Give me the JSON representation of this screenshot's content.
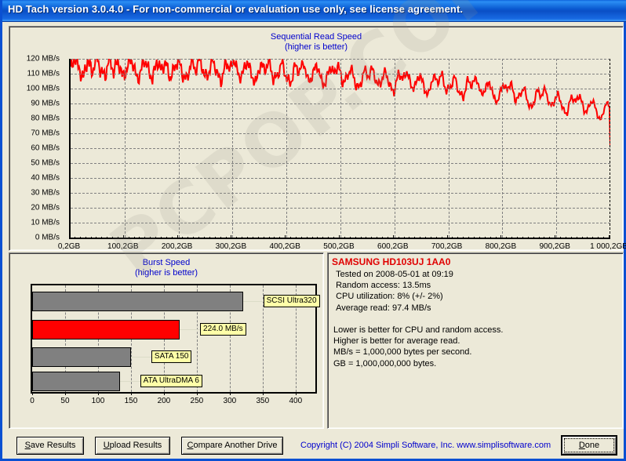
{
  "window": {
    "title": "HD Tach version 3.0.4.0  - For non-commercial or evaluation use only, see license agreement.",
    "watermark": "PCPOP.COM",
    "accent_color": "#0a50d2",
    "face_color": "#ece9d8"
  },
  "sequential": {
    "title_line1": "Sequential Read Speed",
    "title_line2": "(higher is better)",
    "y_labels": [
      "120 MB/s",
      "110 MB/s",
      "100 MB/s",
      "90 MB/s",
      "80 MB/s",
      "70 MB/s",
      "60 MB/s",
      "50 MB/s",
      "40 MB/s",
      "30 MB/s",
      "20 MB/s",
      "10 MB/s",
      "0 MB/s"
    ],
    "x_labels": [
      "0,2GB",
      "100,2GB",
      "200,2GB",
      "300,2GB",
      "400,2GB",
      "500,2GB",
      "600,2GB",
      "700,2GB",
      "800,2GB",
      "900,2GB",
      "1 000,2GB"
    ],
    "line_color": "#ff0000"
  },
  "burst": {
    "title_line1": "Burst Speed",
    "title_line2": "(higher is better)",
    "x_labels": [
      "0",
      "50",
      "100",
      "150",
      "200",
      "250",
      "300",
      "350",
      "400"
    ],
    "bars": [
      {
        "label": "SCSI Ultra320",
        "value": 320,
        "color": "#808080"
      },
      {
        "label": "224.0 MB/s",
        "value": 224,
        "color": "#ff0000"
      },
      {
        "label": "SATA 150",
        "value": 150,
        "color": "#808080"
      },
      {
        "label": "ATA UltraDMA 6",
        "value": 133,
        "color": "#808080"
      }
    ]
  },
  "info": {
    "drive": "SAMSUNG HD103UJ 1AA0",
    "body": " Tested on 2008-05-01 at 09:19\n Random access: 13.5ms\n CPU utilization: 8% (+/- 2%)\n Average read: 97.4 MB/s\n\nLower is better for CPU and random access.\nHigher is better for average read.\nMB/s = 1,000,000 bytes per second.\nGB = 1,000,000,000 bytes."
  },
  "footer": {
    "save_label": "Save Results",
    "upload_label": "Upload Results",
    "compare_label": "Compare Another Drive",
    "done_label": "Done",
    "copyright": "Copyright (C) 2004 Simpli Software, Inc. www.simplisoftware.com"
  },
  "chart_data": [
    {
      "type": "line",
      "title": "Sequential Read Speed (higher is better)",
      "xlabel": "",
      "ylabel": "MB/s",
      "xlim": [
        0.2,
        1000.2
      ],
      "ylim": [
        0,
        120
      ],
      "ytick_step": 10,
      "xtick_step": 100,
      "grid": true,
      "legend": "none",
      "x_unit": "GB",
      "y_unit": "MB/s",
      "series": [
        {
          "name": "Read speed",
          "color": "#ff0000",
          "x": [
            0,
            8,
            16,
            24,
            32,
            40,
            48,
            56,
            64,
            72,
            80,
            88,
            96,
            104,
            112,
            120,
            128,
            136,
            144,
            152,
            160,
            168,
            176,
            184,
            192,
            200,
            208,
            216,
            224,
            232,
            240,
            248,
            256,
            264,
            272,
            280,
            288,
            296,
            304,
            312,
            320,
            328,
            336,
            344,
            352,
            360,
            368,
            376,
            384,
            392,
            400,
            408,
            416,
            424,
            432,
            440,
            448,
            456,
            464,
            472,
            480,
            488,
            496,
            504,
            512,
            520,
            528,
            536,
            544,
            552,
            560,
            568,
            576,
            584,
            592,
            600,
            608,
            616,
            624,
            632,
            640,
            648,
            656,
            664,
            672,
            680,
            688,
            696,
            704,
            712,
            720,
            728,
            736,
            744,
            752,
            760,
            768,
            776,
            784,
            792,
            800,
            808,
            816,
            824,
            832,
            840,
            848,
            856,
            864,
            872,
            880,
            888,
            896,
            904,
            912,
            920,
            928,
            936,
            944,
            952,
            960,
            968,
            976,
            984,
            992,
            1000
          ],
          "y": [
            112,
            121,
            113,
            107,
            120,
            110,
            122,
            112,
            108,
            121,
            111,
            119,
            108,
            112,
            121,
            110,
            107,
            120,
            113,
            106,
            119,
            112,
            118,
            107,
            113,
            120,
            109,
            106,
            119,
            112,
            121,
            108,
            110,
            120,
            109,
            105,
            118,
            113,
            120,
            107,
            111,
            119,
            108,
            104,
            117,
            112,
            119,
            106,
            109,
            118,
            107,
            103,
            116,
            111,
            118,
            105,
            108,
            117,
            106,
            102,
            115,
            110,
            116,
            104,
            107,
            114,
            103,
            100,
            113,
            108,
            114,
            102,
            105,
            112,
            101,
            98,
            111,
            106,
            112,
            100,
            103,
            110,
            99,
            96,
            109,
            104,
            110,
            98,
            101,
            108,
            97,
            94,
            106,
            102,
            108,
            96,
            99,
            105,
            94,
            91,
            103,
            99,
            104,
            92,
            95,
            101,
            90,
            87,
            99,
            95,
            100,
            88,
            91,
            97,
            86,
            83,
            95,
            91,
            96,
            84,
            87,
            93,
            82,
            79,
            91,
            87,
            92,
            80,
            83,
            89,
            76,
            62
          ]
        }
      ],
      "annotations": [
        "average read 97.4 MB/s"
      ]
    },
    {
      "type": "bar",
      "orientation": "horizontal",
      "title": "Burst Speed (higher is better)",
      "categories": [
        "SCSI Ultra320",
        "224.0 MB/s",
        "SATA 150",
        "ATA UltraDMA 6"
      ],
      "values": [
        320,
        224,
        150,
        133
      ],
      "colors": [
        "#808080",
        "#ff0000",
        "#808080",
        "#808080"
      ],
      "xlabel": "",
      "ylabel": "",
      "xlim": [
        0,
        430
      ],
      "xtick_step": 50,
      "grid": true,
      "legend": "none",
      "x_unit": "MB/s"
    }
  ]
}
